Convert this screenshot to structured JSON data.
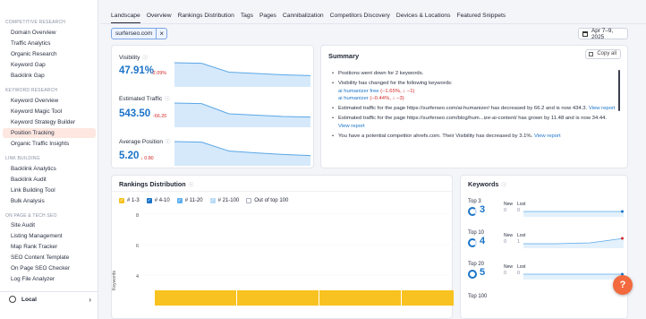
{
  "sidebar": {
    "sections": [
      {
        "title": "COMPETITIVE RESEARCH",
        "items": [
          "Domain Overview",
          "Traffic Analytics",
          "Organic Research",
          "Keyword Gap",
          "Backlink Gap"
        ]
      },
      {
        "title": "KEYWORD RESEARCH",
        "items": [
          "Keyword Overview",
          "Keyword Magic Tool",
          "Keyword Strategy Builder",
          "Position Tracking",
          "Organic Traffic Insights"
        ]
      },
      {
        "title": "LINK BUILDING",
        "items": [
          "Backlink Analytics",
          "Backlink Audit",
          "Link Building Tool",
          "Bulk Analysis"
        ]
      },
      {
        "title": "ON PAGE & TECH SEO",
        "items": [
          "Site Audit",
          "Listing Management",
          "Map Rank Tracker",
          "SEO Content Template",
          "On Page SEO Checker",
          "Log File Analyzer"
        ]
      }
    ],
    "active_item": "Position Tracking",
    "local_label": "Local"
  },
  "tabs": [
    "Landscape",
    "Overview",
    "Rankings Distribution",
    "Tags",
    "Pages",
    "Cannibalization",
    "Competitors Discovery",
    "Devices & Locations",
    "Featured Snippets"
  ],
  "active_tab": "Landscape",
  "domain": "surferseo.com",
  "date_range": "Apr 7–9, 2025",
  "metrics": [
    {
      "label": "Visibility",
      "value": "47.91%",
      "delta": "-2.09%",
      "trend": [
        0.9,
        0.88,
        0.55,
        0.5,
        0.45,
        0.42
      ]
    },
    {
      "label": "Estimated Traffic",
      "value": "543.50",
      "delta": "-66.20",
      "trend": [
        0.9,
        0.88,
        0.5,
        0.45,
        0.4,
        0.38
      ]
    },
    {
      "label": "Average Position",
      "value": "5.20",
      "delta": "↓ 0.80",
      "trend": [
        0.9,
        0.88,
        0.55,
        0.48,
        0.42,
        0.38
      ]
    }
  ],
  "summary": {
    "title": "Summary",
    "copy_label": "Copy all",
    "line1": "Positions went down for 2 keywords.",
    "line2": "Visibility has changed for the following keywords:",
    "kw1_name": "ai humanizer free",
    "kw1_delta": "(–1.65%, ↓ –1)",
    "kw2_name": "ai humanizer",
    "kw2_delta": "(–0.44%, ↓ –3)",
    "line3": "Estimated traffic for the page https://surferseo.com/ai-humanizer/ has decreased by 66.2 and is now 434.3.",
    "line4": "Estimated traffic for the page https://surferseo.com/blog/hum...ize-ai-content/ has grown by 11.48 and is now 34.44.",
    "line5": "You have a potential competitor ahrefs.com. Their Visibility has decreased by 3.1%.",
    "view_report": "View report"
  },
  "rankings": {
    "title": "Rankings Distribution",
    "legend": [
      "# 1-3",
      "# 4-10",
      "# 11-20",
      "# 21-100",
      "Out of top 100"
    ],
    "ylabel": "Keywords",
    "yticks": [
      "8",
      "6",
      "4"
    ]
  },
  "chart_data": {
    "type": "bar",
    "ylabel": "Keywords",
    "ylim": [
      2,
      9
    ],
    "series": [
      {
        "name": "# 1-3",
        "values": [
          3,
          3,
          3,
          3
        ]
      }
    ],
    "values": [
      3,
      3,
      3,
      3
    ]
  },
  "keywords": {
    "title": "Keywords",
    "new_label": "New",
    "lost_label": "Lost",
    "rows": [
      {
        "label": "Top 3",
        "value": "3",
        "new": "0",
        "lost": "0",
        "trend": [
          0.3,
          0.3,
          0.3,
          0.3
        ]
      },
      {
        "label": "Top 10",
        "value": "4",
        "new": "0",
        "lost": "1",
        "trend": [
          0.25,
          0.25,
          0.3,
          0.55
        ]
      },
      {
        "label": "Top 20",
        "value": "5",
        "new": "0",
        "lost": "0",
        "trend": [
          0.3,
          0.3,
          0.3,
          0.3
        ]
      },
      {
        "label": "Top 100",
        "value": "",
        "new": "",
        "lost": "",
        "trend": []
      }
    ]
  },
  "colors": {
    "accent": "#1a73c8",
    "negative": "#d32a2a",
    "bar": "#f8c220",
    "active_bg": "#fde7e0",
    "help": "#f26a3d"
  },
  "help_label": "?"
}
